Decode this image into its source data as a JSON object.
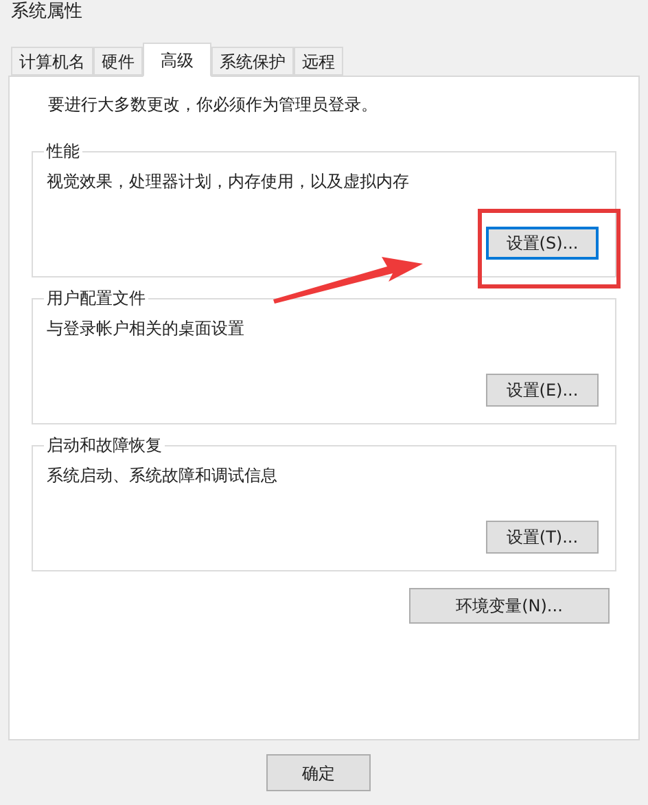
{
  "window": {
    "title": "系统属性"
  },
  "tabs": [
    {
      "label": "计算机名",
      "selected": false
    },
    {
      "label": "硬件",
      "selected": false
    },
    {
      "label": "高级",
      "selected": true
    },
    {
      "label": "系统保护",
      "selected": false
    },
    {
      "label": "远程",
      "selected": false
    }
  ],
  "notice": "要进行大多数更改，你必须作为管理员登录。",
  "groups": [
    {
      "title": "性能",
      "description": "视觉效果，处理器计划，内存使用，以及虚拟内存",
      "button": {
        "label": "设置(S)...",
        "focused": true
      },
      "highlighted": true
    },
    {
      "title": "用户配置文件",
      "description": "与登录帐户相关的桌面设置",
      "button": {
        "label": "设置(E)...",
        "focused": false
      },
      "highlighted": false
    },
    {
      "title": "启动和故障恢复",
      "description": "系统启动、系统故障和调试信息",
      "button": {
        "label": "设置(T)...",
        "focused": false
      },
      "highlighted": false
    }
  ],
  "env_button": "环境变量(N)...",
  "footer_buttons": [
    "确定"
  ]
}
